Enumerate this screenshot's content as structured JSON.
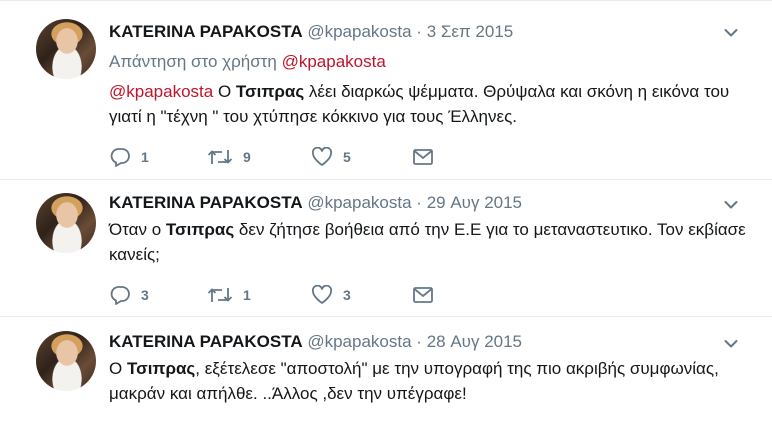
{
  "tweets": [
    {
      "name": "KATERINA PAPAKOSTA",
      "handle": "@kpapakosta",
      "separator": "·",
      "date": "3 Σεπ 2015",
      "reply_prefix": "Απάντηση στο χρήστη",
      "reply_handle": "@kpapakosta",
      "text_mention": "@kpapakosta",
      "text_a": " Ο ",
      "text_bold": "Τσιπρας",
      "text_b": " λέει διαρκώς ψέμματα. Θρύψαλα και σκόνη η εικόνα του γιατί η \"τέχνη \" του χτύπησε κόκκινο για τους Έλληνες.",
      "replies": "1",
      "retweets": "9",
      "likes": "5"
    },
    {
      "name": "KATERINA PAPAKOSTA",
      "handle": "@kpapakosta",
      "separator": "·",
      "date": "29 Αυγ 2015",
      "text_a": "Όταν ο ",
      "text_bold": "Τσιπρας",
      "text_b": " δεν ζήτησε βοήθεια από την Ε.Ε για το μεταναστευτικο. Τον εκβίασε κανείς;",
      "replies": "3",
      "retweets": "1",
      "likes": "3"
    },
    {
      "name": "KATERINA PAPAKOSTA",
      "handle": "@kpapakosta",
      "separator": "·",
      "date": "28 Αυγ 2015",
      "text_a": "Ο ",
      "text_bold": "Τσιπρας",
      "text_b": ", εξέτελεσε \"αποστολή\" με την υπογραφή της πιο ακριβής συμφωνίας, μακράν και απήλθε. ..Άλλος ,δεν την υπέγραφε!"
    }
  ],
  "icons": {
    "reply": "reply-icon",
    "retweet": "retweet-icon",
    "like": "heart-icon",
    "message": "envelope-icon",
    "more": "chevron-down-icon"
  },
  "colors": {
    "mention": "#c0142a",
    "meta": "#657786",
    "divider": "#e6ecf0"
  }
}
